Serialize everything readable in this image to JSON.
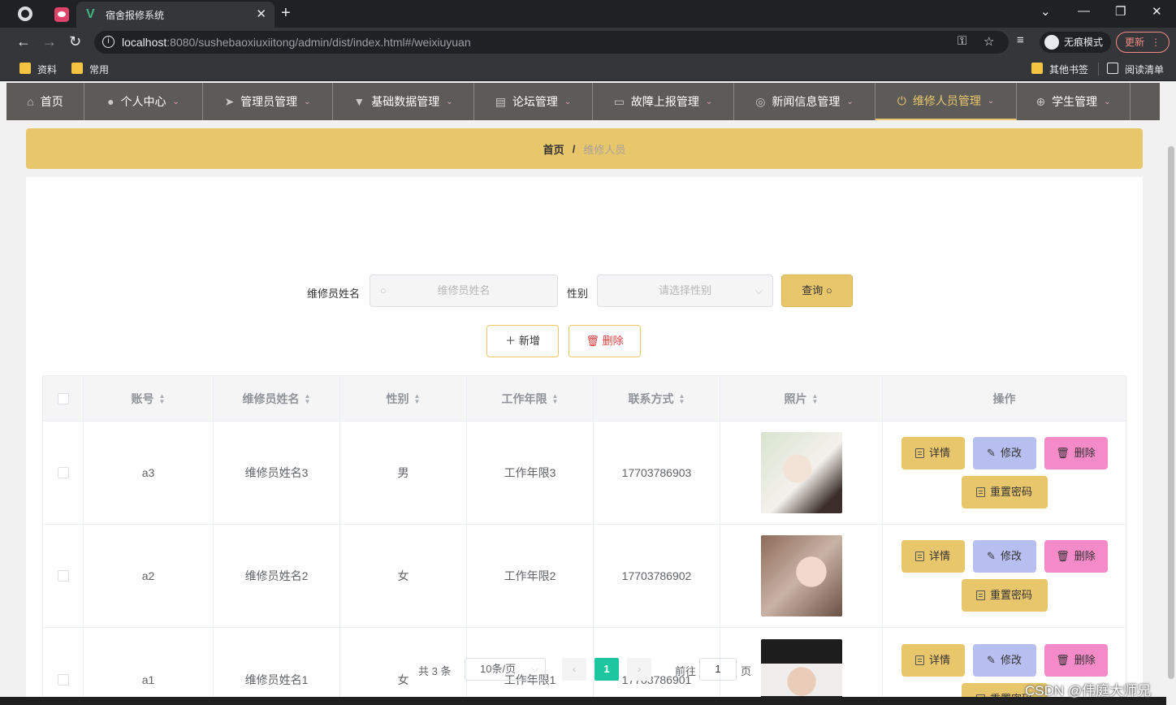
{
  "browser": {
    "tab_title": "宿舍报修系统",
    "url_host": "localhost",
    "url_rest": ":8080/sushebaoxiuxiitong/admin/dist/index.html#/weixiuyuan",
    "incognito_label": "无痕模式",
    "update_label": "更新",
    "bookmarks": [
      "资料",
      "常用"
    ],
    "other_bookmarks": "其他书签",
    "reading_list": "阅读清单"
  },
  "nav": {
    "items": [
      {
        "label": "首页",
        "icon": "home-icon"
      },
      {
        "label": "个人中心",
        "icon": "user-icon"
      },
      {
        "label": "管理员管理",
        "icon": "paper-plane-icon"
      },
      {
        "label": "基础数据管理",
        "icon": "brush-icon"
      },
      {
        "label": "论坛管理",
        "icon": "clipboard-icon"
      },
      {
        "label": "故障上报管理",
        "icon": "monitor-icon"
      },
      {
        "label": "新闻信息管理",
        "icon": "lifebuoy-icon"
      },
      {
        "label": "维修人员管理",
        "icon": "power-icon"
      },
      {
        "label": "学生管理",
        "icon": "crosshair-icon"
      }
    ],
    "active_index": 7
  },
  "breadcrumb": {
    "home": "首页",
    "separator": "/",
    "current": "维修人员"
  },
  "search": {
    "name_label": "维修员姓名",
    "name_placeholder": "维修员姓名",
    "gender_label": "性别",
    "gender_placeholder": "请选择性别",
    "query_label": "查询"
  },
  "actions": {
    "add_label": "新增",
    "delete_label": "删除"
  },
  "table": {
    "headers": [
      "账号",
      "维修员姓名",
      "性别",
      "工作年限",
      "联系方式",
      "照片",
      "操作"
    ],
    "rows": [
      {
        "account": "a3",
        "name": "维修员姓名3",
        "gender": "男",
        "years": "工作年限3",
        "phone": "17703786903"
      },
      {
        "account": "a2",
        "name": "维修员姓名2",
        "gender": "女",
        "years": "工作年限2",
        "phone": "17703786902"
      },
      {
        "account": "a1",
        "name": "维修员姓名1",
        "gender": "女",
        "years": "工作年限1",
        "phone": "17703786901"
      }
    ],
    "row_ops": {
      "detail": "详情",
      "edit": "修改",
      "remove": "删除",
      "reset": "重置密码"
    }
  },
  "pagination": {
    "total": "共 3 条",
    "page_size": "10条/页",
    "current_page": "1",
    "goto_label": "前往",
    "goto_value": "1",
    "page_suffix": "页"
  },
  "watermark": "CSDN @伟庭大师兄",
  "colors": {
    "accent": "#e8c66b",
    "nav_bg": "#5d5b58",
    "page_active": "#1ec6a0",
    "edit_btn": "#b7bff0",
    "remove_btn": "#f48ac8"
  }
}
